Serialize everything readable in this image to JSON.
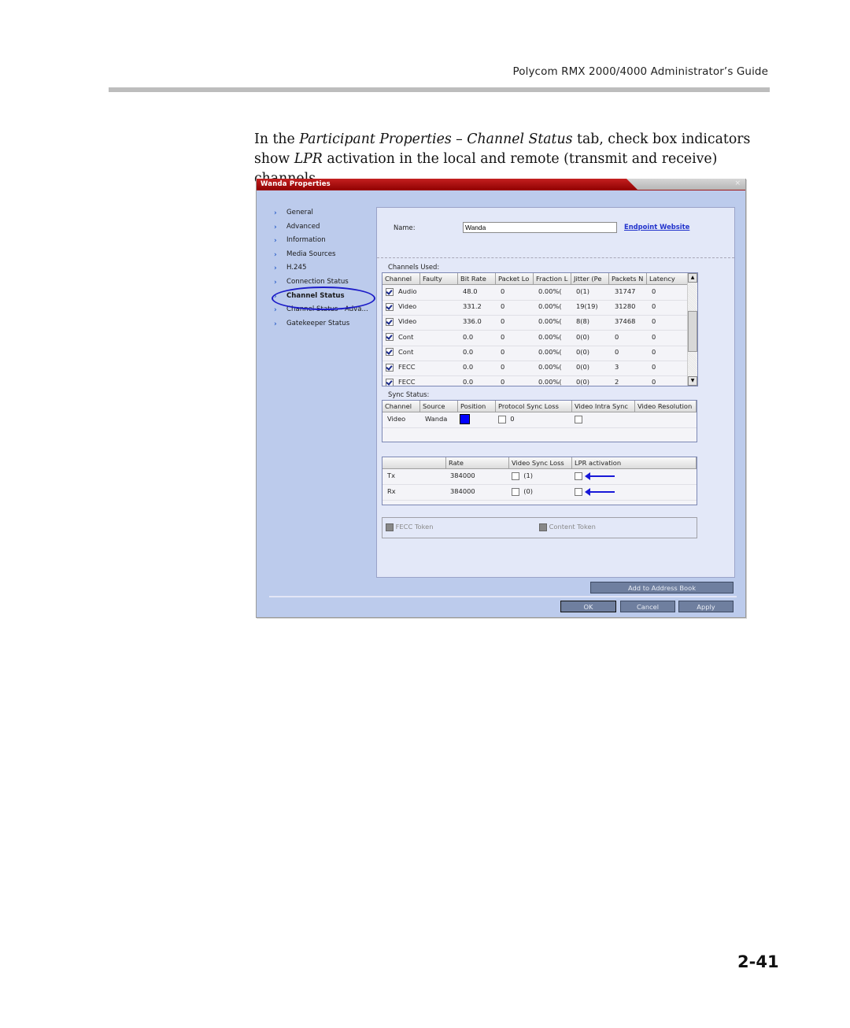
{
  "document": {
    "header_title": "Polycom RMX 2000/4000 Administrator’s Guide",
    "intro_parts": {
      "p1": "In the ",
      "italic1": "Participant Properties – Channel Status",
      "p2": " tab, check box indicators show ",
      "italic2": "LPR",
      "p3": " activation in the local and remote (transmit and receive) channels."
    },
    "page_number": "2-41"
  },
  "dialog": {
    "title": "Wanda Properties",
    "close_glyph": "×",
    "nav": [
      {
        "label": "General",
        "active": false
      },
      {
        "label": "Advanced",
        "active": false
      },
      {
        "label": "Information",
        "active": false
      },
      {
        "label": "Media Sources",
        "active": false
      },
      {
        "label": "H.245",
        "active": false
      },
      {
        "label": "Connection Status",
        "active": false
      },
      {
        "label": "Channel Status",
        "active": true
      },
      {
        "label": "Channel Status - Adva...",
        "active": false
      },
      {
        "label": "Gatekeeper Status",
        "active": false
      }
    ],
    "name_label": "Name:",
    "name_value": "Wanda",
    "endpoint_link": "Endpoint Website",
    "channels_used_label": "Channels Used:",
    "channels": {
      "columns": [
        "Channel",
        "Faulty",
        "Bit Rate",
        "Packet Lo",
        "Fraction L",
        "Jitter (Pe",
        "Packets N",
        "Latency"
      ],
      "rows": [
        {
          "checked": true,
          "channel": "Audio",
          "faulty": "",
          "bit_rate": "48.0",
          "packet_loss": "0",
          "fraction": "0.00%(",
          "jitter": "0(1)",
          "packets": "31747",
          "latency": "0"
        },
        {
          "checked": true,
          "channel": "Video",
          "faulty": "",
          "bit_rate": "331.2",
          "packet_loss": "0",
          "fraction": "0.00%(",
          "jitter": "19(19)",
          "packets": "31280",
          "latency": "0"
        },
        {
          "checked": true,
          "channel": "Video",
          "faulty": "",
          "bit_rate": "336.0",
          "packet_loss": "0",
          "fraction": "0.00%(",
          "jitter": "8(8)",
          "packets": "37468",
          "latency": "0"
        },
        {
          "checked": true,
          "channel": "Cont",
          "faulty": "",
          "bit_rate": "0.0",
          "packet_loss": "0",
          "fraction": "0.00%(",
          "jitter": "0(0)",
          "packets": "0",
          "latency": "0"
        },
        {
          "checked": true,
          "channel": "Cont",
          "faulty": "",
          "bit_rate": "0.0",
          "packet_loss": "0",
          "fraction": "0.00%(",
          "jitter": "0(0)",
          "packets": "0",
          "latency": "0"
        },
        {
          "checked": true,
          "channel": "FECC",
          "faulty": "",
          "bit_rate": "0.0",
          "packet_loss": "0",
          "fraction": "0.00%(",
          "jitter": "0(0)",
          "packets": "3",
          "latency": "0"
        },
        {
          "checked": true,
          "channel": "FECC",
          "faulty": "",
          "bit_rate": "0.0",
          "packet_loss": "0",
          "fraction": "0.00%(",
          "jitter": "0(0)",
          "packets": "2",
          "latency": "0"
        }
      ]
    },
    "sync_status_label": "Sync Status:",
    "sync": {
      "columns": [
        "Channel",
        "Source",
        "Position",
        "Protocol Sync Loss",
        "Video Intra Sync",
        "Video Resolution"
      ],
      "rows": [
        {
          "channel": "Video",
          "source": "Wanda",
          "position_color": "#0000ff",
          "protocol_sync_loss_checked": false,
          "protocol_sync_loss_value": "0",
          "video_intra_sync_checked": false,
          "video_resolution": ""
        }
      ]
    },
    "rates": {
      "columns": [
        "",
        "Rate",
        "Video Sync Loss",
        "LPR activation"
      ],
      "rows": [
        {
          "direction": "Tx",
          "rate": "384000",
          "video_sync_loss_checked": false,
          "video_sync_loss_value": "(1)",
          "lpr_activation": false
        },
        {
          "direction": "Rx",
          "rate": "384000",
          "video_sync_loss_checked": false,
          "video_sync_loss_value": "(0)",
          "lpr_activation": false
        }
      ]
    },
    "tokens": {
      "fecc_label": "FECC Token",
      "content_label": "Content Token"
    },
    "buttons": {
      "add_to_address_book": "Add to Address Book",
      "ok": "OK",
      "cancel": "Cancel",
      "apply": "Apply"
    }
  },
  "colors": {
    "title_bar_red": "#a00000",
    "dialog_bg": "#bccbec",
    "panel_bg": "#e3e8f8",
    "annotation_blue": "#1818d8",
    "button_bg": "#6f7f9f"
  }
}
